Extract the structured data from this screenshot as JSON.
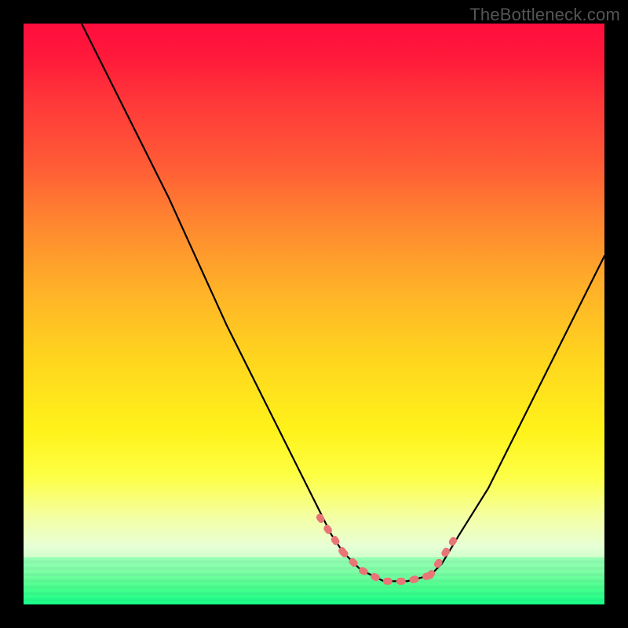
{
  "watermark": "TheBottleneck.com",
  "colors": {
    "background": "#000000",
    "curve_stroke": "#000000",
    "highlight_stroke": "#e87676",
    "gradient_top": "#ff0d3e",
    "gradient_mid1": "#ffb228",
    "gradient_mid2": "#fff21a",
    "gradient_bottom": "#1fff9a"
  },
  "chart_data": {
    "type": "line",
    "title": "",
    "xlabel": "",
    "ylabel": "",
    "xlim": [
      0,
      100
    ],
    "ylim": [
      0,
      100
    ],
    "note": "Values read in percent of plot-area; y=0 at bottom, y=100 at top. Curve is a V-shaped bottleneck with flat minimum; highlight segments mark the near-minimum region.",
    "series": [
      {
        "name": "curve",
        "x": [
          10,
          15,
          20,
          25,
          30,
          35,
          40,
          45,
          50,
          53,
          55,
          58,
          62,
          66,
          70,
          72,
          75,
          80,
          85,
          90,
          95,
          100
        ],
        "y": [
          100,
          90,
          80,
          70,
          59,
          48,
          38,
          28,
          18,
          12,
          9,
          6,
          4,
          4,
          5,
          7,
          12,
          20,
          30,
          40,
          50,
          60
        ]
      },
      {
        "name": "highlight_left",
        "x": [
          51,
          53,
          55
        ],
        "y": [
          15,
          12,
          9
        ]
      },
      {
        "name": "highlight_flat",
        "x": [
          55,
          58,
          62,
          66,
          70
        ],
        "y": [
          9,
          6,
          4,
          4,
          5
        ]
      },
      {
        "name": "highlight_right",
        "x": [
          70,
          72,
          74
        ],
        "y": [
          5,
          8,
          11
        ]
      }
    ]
  }
}
